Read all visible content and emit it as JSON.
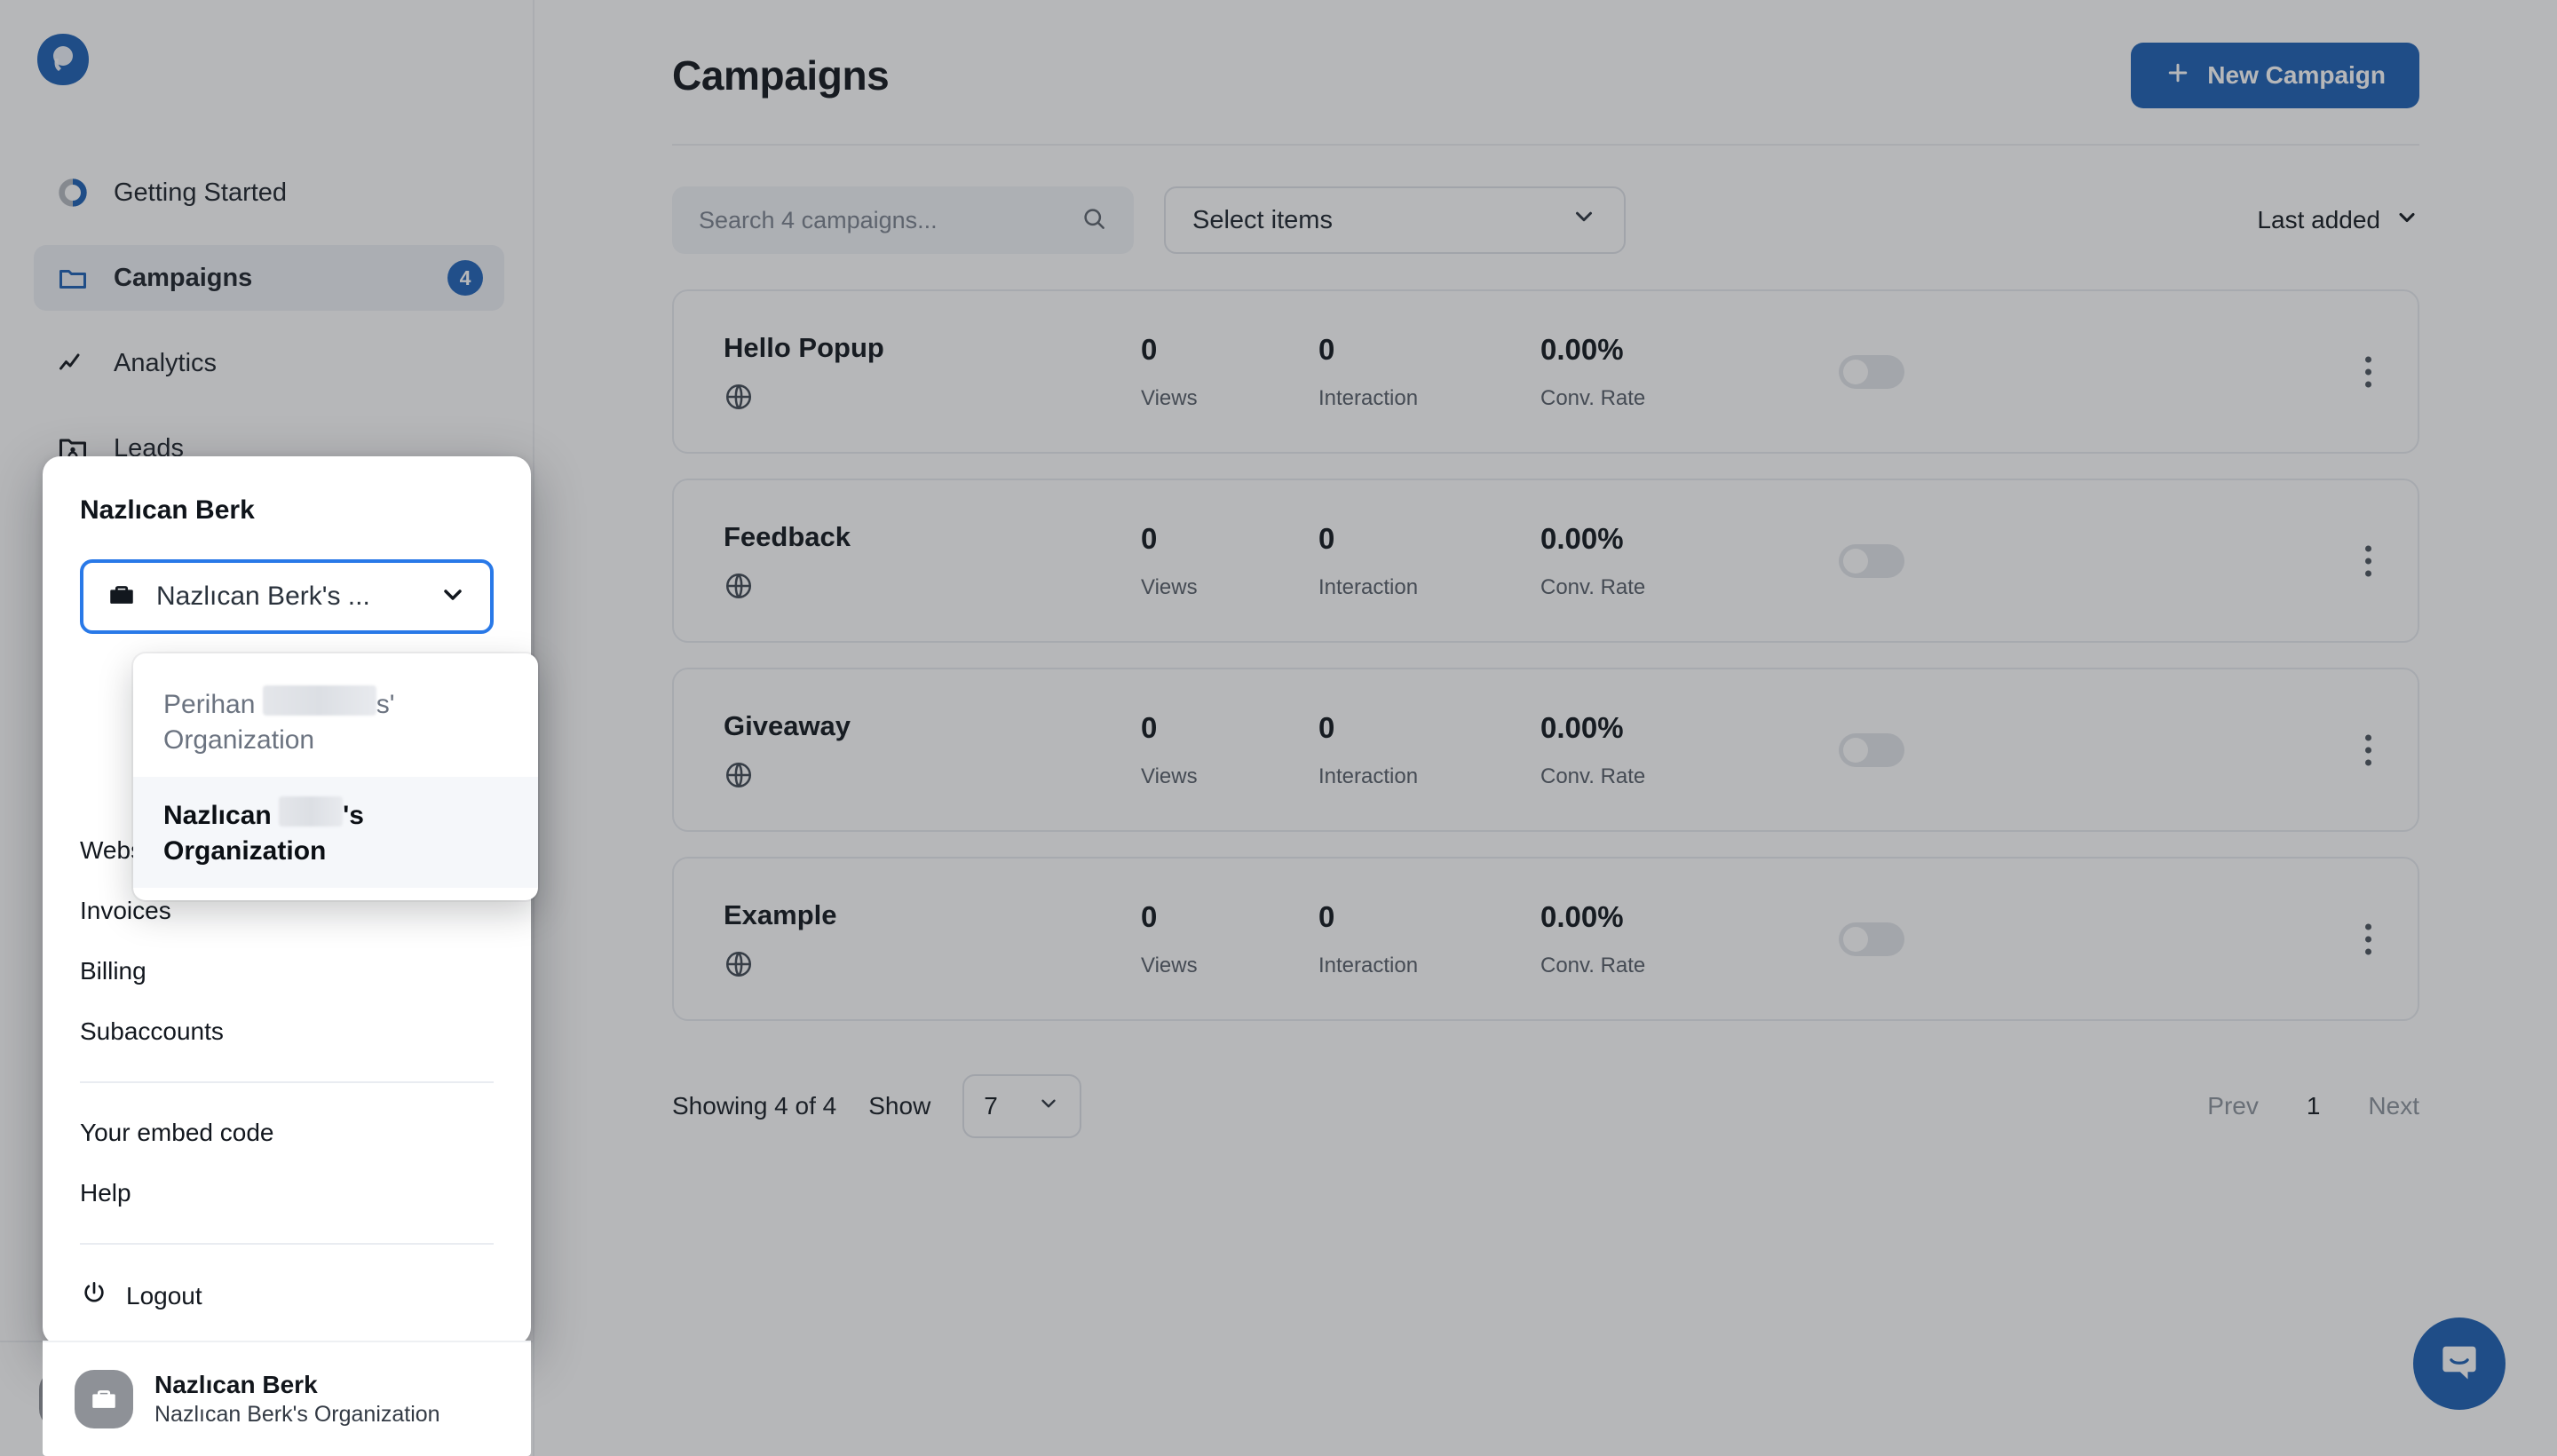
{
  "brand": {
    "accent": "#1a5fb4",
    "focus_blue": "#2979e8",
    "logo_icon": "popupsmart-logo-icon"
  },
  "sidebar": {
    "items": [
      {
        "label": "Getting Started",
        "icon": "progress-ring-icon",
        "badge": null,
        "active": false
      },
      {
        "label": "Campaigns",
        "icon": "folder-icon",
        "badge": "4",
        "active": true
      },
      {
        "label": "Analytics",
        "icon": "line-chart-icon",
        "badge": null,
        "active": false
      },
      {
        "label": "Leads",
        "icon": "folder-user-icon",
        "badge": null,
        "active": false
      }
    ],
    "footer": {
      "avatar_icon": "briefcase-icon",
      "name": "Nazlıcan Berk",
      "organization": "Nazlıcan Berk's Organization"
    }
  },
  "header": {
    "title": "Campaigns",
    "new_campaign_label": "New Campaign",
    "plus_icon": "plus-icon"
  },
  "toolbar": {
    "search_placeholder": "Search 4 campaigns...",
    "search_value": "",
    "search_icon": "search-icon",
    "select_items_label": "Select items",
    "chevron_icon": "chevron-down-icon",
    "sort_label": "Last added"
  },
  "table": {
    "metric_labels": {
      "views": "Views",
      "interaction": "Interaction",
      "conv_rate": "Conv. Rate"
    },
    "row_icon": "globe-icon",
    "menu_icon": "kebab-menu-icon",
    "rows": [
      {
        "name": "Hello Popup",
        "views": "0",
        "interaction": "0",
        "conv_rate": "0.00%",
        "enabled": false
      },
      {
        "name": "Feedback",
        "views": "0",
        "interaction": "0",
        "conv_rate": "0.00%",
        "enabled": false
      },
      {
        "name": "Giveaway",
        "views": "0",
        "interaction": "0",
        "conv_rate": "0.00%",
        "enabled": false
      },
      {
        "name": "Example",
        "views": "0",
        "interaction": "0",
        "conv_rate": "0.00%",
        "enabled": false
      }
    ]
  },
  "pagination": {
    "showing": "Showing 4 of 4",
    "show_label": "Show",
    "page_size": "7",
    "prev": "Prev",
    "current_page": "1",
    "next": "Next"
  },
  "account_popup": {
    "title": "Nazlıcan Berk",
    "org_select": {
      "icon": "briefcase-icon",
      "value": "Nazlıcan Berk's ...",
      "chevron_icon": "chevron-down-icon"
    },
    "org_options": [
      {
        "prefix": "Perihan ",
        "redacted": true,
        "suffix": "s'",
        "second_line": "Organization",
        "selected": false
      },
      {
        "prefix": "Nazlıcan ",
        "redacted": true,
        "suffix": "'s",
        "second_line": "Organization",
        "selected": true
      }
    ],
    "links": [
      "Websites",
      "Invoices",
      "Billing",
      "Subaccounts"
    ],
    "links_secondary": [
      "Your embed code",
      "Help"
    ],
    "logout_label": "Logout",
    "logout_icon": "power-icon"
  },
  "intercom": {
    "icon": "chat-bubble-icon"
  }
}
